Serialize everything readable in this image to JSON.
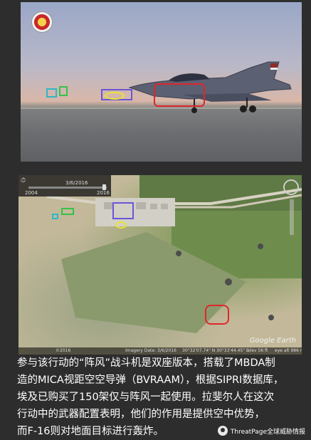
{
  "photo": {
    "colors": {
      "red_box": "#e0262b",
      "cyan_box": "#30b6c6",
      "green_box": "#35c24a",
      "purple_box": "#6a55d6",
      "yellow_ellipse": "#e9e238"
    }
  },
  "map": {
    "timeline": {
      "start_year": "2004",
      "date": "3/6/2016",
      "end_year": "2016"
    },
    "footer": {
      "copyright": "Imagery Date: 3/6/2016",
      "coords": "30°32'07.74\" N  30°33'44.45\" E",
      "elev": "elev 56 ft",
      "eye_alt": "eye alt 986 m",
      "year": "©2016"
    },
    "logo": "Google Earth"
  },
  "caption": {
    "lines": [
      "参与该行动的“阵风”战斗机是双座版本，搭载了MBDA制",
      "造的MICA视距空空导弹（BVRAAM），根据SIPRI数据库，",
      "埃及已购买了150架仅与阵风一起使用。拉斐尔人在这次",
      "行动中的武器配置表明，他们的作用是提供空中优势，",
      "而F-16则对地面目标进行轰炸。"
    ]
  },
  "watermark": {
    "label": "ThreatPage全球威胁情报"
  }
}
